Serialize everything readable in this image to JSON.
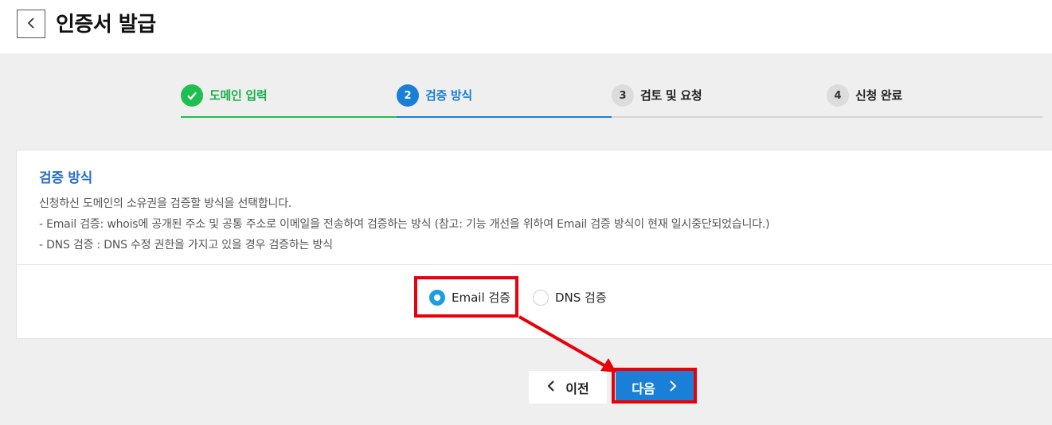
{
  "header": {
    "title": "인증서 발급"
  },
  "stepper": {
    "steps": [
      {
        "index": "",
        "label": "도메인 입력",
        "status": "done"
      },
      {
        "index": "2",
        "label": "검증 방식",
        "status": "active"
      },
      {
        "index": "3",
        "label": "검토 및 요청",
        "status": "pending"
      },
      {
        "index": "4",
        "label": "신청 완료",
        "status": "pending"
      }
    ]
  },
  "panel": {
    "title": "검증 방식",
    "description": [
      "신청하신 도메인의 소유권을 검증할 방식을 선택합니다.",
      "- Email 검증: whois에 공개된 주소 및 공통 주소로 이메일을 전송하여 검증하는 방식 (참고: 기능 개선을 위하여 Email 검증 방식이 현재 일시중단되었습니다.)",
      "- DNS 검증 : DNS 수정 권한을 가지고 있을 경우 검증하는 방식"
    ],
    "options": [
      {
        "label": "Email 검증",
        "selected": true
      },
      {
        "label": "DNS 검증",
        "selected": false
      }
    ]
  },
  "actions": {
    "prev_label": "이전",
    "next_label": "다음"
  },
  "colors": {
    "accent": "#1a7fd6",
    "done": "#1fbf4f",
    "highlight": "#e8000b"
  },
  "icons": {
    "back": "chevron-left-icon",
    "done": "check-icon",
    "prev": "chevron-left-icon",
    "next": "chevron-right-icon"
  }
}
